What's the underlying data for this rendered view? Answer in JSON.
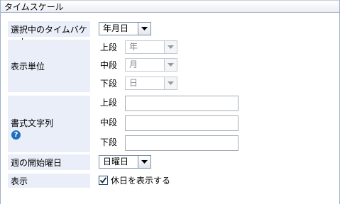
{
  "panel": {
    "title": "タイムスケール"
  },
  "selected_bucket": {
    "label": "選択中のタイムバケット",
    "value": "年月日"
  },
  "display_unit": {
    "label": "表示単位",
    "rows": [
      {
        "sub": "上段",
        "value": "年"
      },
      {
        "sub": "中段",
        "value": "月"
      },
      {
        "sub": "下段",
        "value": "日"
      }
    ]
  },
  "format_string": {
    "label": "書式文字列",
    "rows": [
      {
        "sub": "上段",
        "value": ""
      },
      {
        "sub": "中段",
        "value": ""
      },
      {
        "sub": "下段",
        "value": ""
      }
    ]
  },
  "week_start": {
    "label": "週の開始曜日",
    "value": "日曜日"
  },
  "display": {
    "label": "表示",
    "checkbox_label": "休日を表示する",
    "checked": true
  }
}
